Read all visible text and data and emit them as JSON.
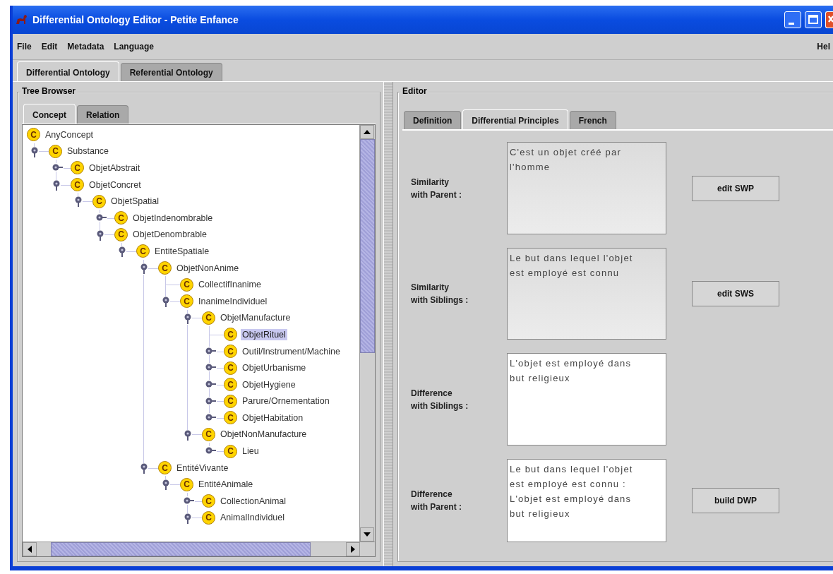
{
  "window": {
    "title": "Differential Ontology Editor - Petite Enfance"
  },
  "menu": [
    {
      "label": "File"
    },
    {
      "label": "Edit"
    },
    {
      "label": "Metadata"
    },
    {
      "label": "Language"
    }
  ],
  "help_menu": {
    "label": "Hel"
  },
  "main_tabs": [
    {
      "label": "Differential Ontology",
      "selected": true
    },
    {
      "label": "Referential Ontology",
      "selected": false
    }
  ],
  "tree_browser": {
    "title": "Tree Browser",
    "tabs": [
      {
        "label": "Concept",
        "selected": true
      },
      {
        "label": "Relation",
        "selected": false
      }
    ],
    "tree": [
      {
        "label": "AnyConcept",
        "badge": "C",
        "selected": false,
        "children": [
          {
            "label": "Substance",
            "badge": "C",
            "selected": false,
            "expanded": true,
            "children": [
              {
                "label": "ObjetAbstrait",
                "badge": "C",
                "selected": false,
                "expanded": false
              },
              {
                "label": "ObjetConcret",
                "badge": "C",
                "selected": false,
                "expanded": true,
                "children": [
                  {
                    "label": "ObjetSpatial",
                    "badge": "C",
                    "selected": false,
                    "expanded": true,
                    "children": [
                      {
                        "label": "ObjetIndenombrable",
                        "badge": "C",
                        "selected": false,
                        "expanded": false
                      },
                      {
                        "label": "ObjetDenombrable",
                        "badge": "C",
                        "selected": false,
                        "expanded": true,
                        "children": [
                          {
                            "label": "EntiteSpatiale",
                            "badge": "C",
                            "selected": false,
                            "expanded": true,
                            "children": [
                              {
                                "label": "ObjetNonAnime",
                                "badge": "C",
                                "selected": false,
                                "expanded": true,
                                "children": [
                                  {
                                    "label": "CollectifInanime",
                                    "badge": "C",
                                    "selected": false
                                  },
                                  {
                                    "label": "InanimeIndividuel",
                                    "badge": "C",
                                    "selected": false,
                                    "expanded": true,
                                    "children": [
                                      {
                                        "label": "ObjetManufacture",
                                        "badge": "C",
                                        "selected": false,
                                        "expanded": true,
                                        "children": [
                                          {
                                            "label": "ObjetRituel",
                                            "badge": "C",
                                            "selected": true
                                          },
                                          {
                                            "label": "Outil/Instrument/Machine",
                                            "badge": "C",
                                            "selected": false,
                                            "expanded": false
                                          },
                                          {
                                            "label": "ObjetUrbanisme",
                                            "badge": "C",
                                            "selected": false,
                                            "expanded": false
                                          },
                                          {
                                            "label": "ObjetHygiene",
                                            "badge": "C",
                                            "selected": false,
                                            "expanded": false
                                          },
                                          {
                                            "label": "Parure/Ornementation",
                                            "badge": "C",
                                            "selected": false,
                                            "expanded": false
                                          },
                                          {
                                            "label": "ObjetHabitation",
                                            "badge": "C",
                                            "selected": false,
                                            "expanded": false
                                          }
                                        ]
                                      },
                                      {
                                        "label": "ObjetNonManufacture",
                                        "badge": "C",
                                        "selected": false,
                                        "expanded": true,
                                        "children": [
                                          {
                                            "label": "Lieu",
                                            "badge": "C",
                                            "selected": false,
                                            "expanded": false
                                          }
                                        ]
                                      }
                                    ]
                                  }
                                ]
                              },
                              {
                                "label": "EntitéVivante",
                                "badge": "C",
                                "selected": false,
                                "expanded": true,
                                "children": [
                                  {
                                    "label": "EntitéAnimale",
                                    "badge": "C",
                                    "selected": false,
                                    "expanded": true,
                                    "children": [
                                      {
                                        "label": "CollectionAnimal",
                                        "badge": "C",
                                        "selected": false,
                                        "expanded": false
                                      },
                                      {
                                        "label": "AnimalIndividuel",
                                        "badge": "C",
                                        "selected": false,
                                        "expanded": true
                                      }
                                    ]
                                  }
                                ]
                              }
                            ]
                          }
                        ]
                      }
                    ]
                  }
                ]
              }
            ]
          }
        ]
      }
    ]
  },
  "editor": {
    "title": "Editor",
    "tabs": [
      {
        "label": "Definition",
        "selected": false
      },
      {
        "label": "Differential Principles",
        "selected": true
      },
      {
        "label": "French",
        "selected": false
      }
    ],
    "rows": [
      {
        "label_lines": [
          "Similarity",
          "with Parent :"
        ],
        "value": "C'est un objet créé par l'homme",
        "editable": false,
        "button": "edit SWP"
      },
      {
        "label_lines": [
          "Similarity",
          "with Siblings :"
        ],
        "value": "Le but dans lequel l'objet est employé est connu",
        "editable": false,
        "button": "edit SWS"
      },
      {
        "label_lines": [
          "Difference",
          "with Siblings :"
        ],
        "value": "L'objet est employé dans but religieux",
        "editable": true
      },
      {
        "label_lines": [
          "Difference",
          "with Parent :"
        ],
        "value": "Le but dans lequel l'objet est employé est connu : L'objet est employé dans but religieux",
        "editable": true,
        "button": "build DWP"
      }
    ]
  }
}
